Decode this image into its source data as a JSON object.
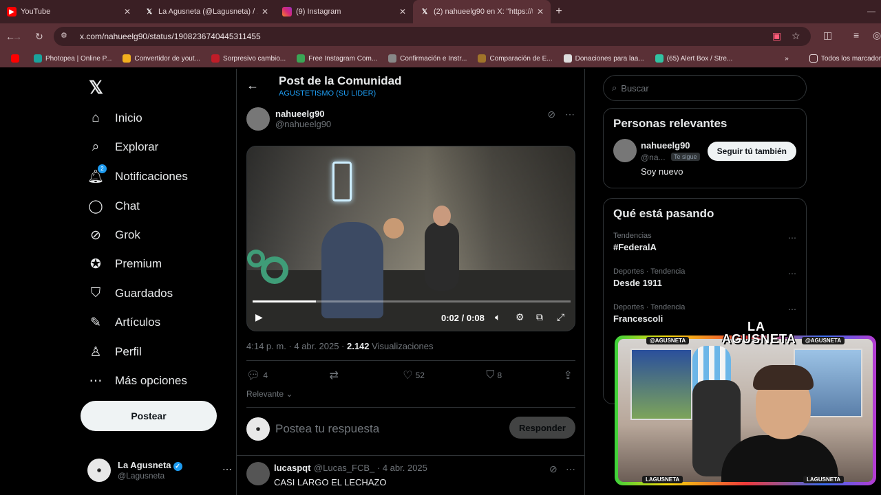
{
  "browser": {
    "tabs": [
      {
        "label": "YouTube",
        "icon": "youtube-icon",
        "color": "#ff0000"
      },
      {
        "label": "La Agusneta (@Lagusneta) / X",
        "icon": "x-icon",
        "color": "#000000"
      },
      {
        "label": "(9) Instagram",
        "icon": "instagram-icon",
        "color": "#d62976"
      },
      {
        "label": "(2) nahueelg90 en X: \"https://t.c",
        "icon": "x-icon",
        "color": "#000000",
        "active": true
      }
    ],
    "url": "x.com/nahueelg90/status/1908236740445311455",
    "bookmarks": [
      {
        "label": "Photopea | Online P...",
        "color": "#1aa39c"
      },
      {
        "label": "Convertidor de yout...",
        "color": "#f2b01e"
      },
      {
        "label": "Sorpresivo cambio...",
        "color": "#c01c28"
      },
      {
        "label": "Free Instagram Com...",
        "color": "#3aa655"
      },
      {
        "label": "Confirmación e Instr...",
        "color": "#888888"
      },
      {
        "label": "Comparación de E...",
        "color": "#a0742a"
      },
      {
        "label": "Donaciones para laa...",
        "color": "#dddddd"
      },
      {
        "label": "(65) Alert Box / Stre...",
        "color": "#31c3a2"
      }
    ],
    "bookmarks_folder": "Todos los marcadores"
  },
  "nav": {
    "items": [
      {
        "label": "Inicio",
        "icon": "home-icon"
      },
      {
        "label": "Explorar",
        "icon": "search-icon"
      },
      {
        "label": "Notificaciones",
        "icon": "bell-icon",
        "badge": "2"
      },
      {
        "label": "Chat",
        "icon": "chat-icon"
      },
      {
        "label": "Grok",
        "icon": "grok-icon"
      },
      {
        "label": "Premium",
        "icon": "premium-icon"
      },
      {
        "label": "Guardados",
        "icon": "bookmark-icon"
      },
      {
        "label": "Artículos",
        "icon": "articles-icon"
      },
      {
        "label": "Perfil",
        "icon": "profile-icon"
      },
      {
        "label": "Más opciones",
        "icon": "more-icon"
      }
    ],
    "post_button": "Postear",
    "account": {
      "name": "La Agusneta",
      "handle": "@Lagusneta"
    }
  },
  "main": {
    "header_title": "Post de la Comunidad",
    "header_sub": "AGUSTETISMO (SU LIDER)",
    "author": {
      "name": "nahueelg90",
      "handle": "@nahueelg90"
    },
    "video": {
      "time": "0:02 / 0:08",
      "progress": 0.2
    },
    "meta": {
      "date": "4:14 p. m. · 4 abr. 2025 · ",
      "views": "2.142",
      "views_label": " Visualizaciones"
    },
    "actions": {
      "replies": "4",
      "reposts": "",
      "likes": "52",
      "bookmarks": "8"
    },
    "sort": "Relevante",
    "reply_placeholder": "Postea tu respuesta",
    "reply_button": "Responder",
    "comment": {
      "name": "lucaspqt",
      "handle": "@Lucas_FCB_ · 4 abr. 2025",
      "text": "CASI LARGO EL LECHAZO"
    }
  },
  "right": {
    "search_placeholder": "Buscar",
    "relevant_title": "Personas relevantes",
    "relevant_user": {
      "name": "nahueelg90",
      "handle": "@na...",
      "tag": "Te sigue",
      "bio": "Soy nuevo",
      "button": "Seguir tú también"
    },
    "trending_title": "Qué está pasando",
    "trends": [
      {
        "category": "Tendencias",
        "name": "#FederalA"
      },
      {
        "category": "Deportes · Tendencia",
        "name": "Desde 1911"
      },
      {
        "category": "Deportes · Tendencia",
        "name": "Francescoli"
      }
    ]
  },
  "overlay": {
    "title": "LA AGUSNETA",
    "labels": [
      "@AGUSNETA",
      "@AGUSNETA",
      "LAGUSNETA",
      "LAGUSNETA"
    ]
  }
}
